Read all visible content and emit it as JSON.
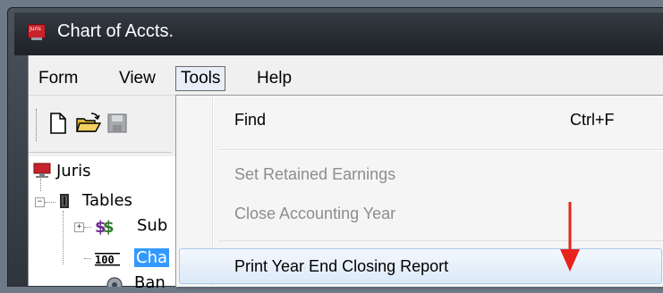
{
  "window": {
    "title": "Chart of Accts.",
    "app_icon_text": "Juris"
  },
  "menubar": {
    "items": [
      "Form",
      "View",
      "Tools",
      "Help"
    ],
    "open_menu": "Tools"
  },
  "toolbar": {
    "buttons": [
      "new-document-icon",
      "open-folder-icon",
      "save-icon"
    ]
  },
  "tree": {
    "root": "Juris",
    "tables": "Tables",
    "sub": "Sub",
    "chart": "Cha",
    "partial": "Ban"
  },
  "tools_menu": {
    "find": "Find",
    "find_shortcut": "Ctrl+F",
    "set_retained": "Set Retained Earnings",
    "close_year": "Close Accounting Year",
    "print_report": "Print Year End Closing Report"
  },
  "colors": {
    "annotation_arrow": "#e8231b",
    "selection": "#3399ff",
    "disabled_text": "#8d8d8d"
  }
}
